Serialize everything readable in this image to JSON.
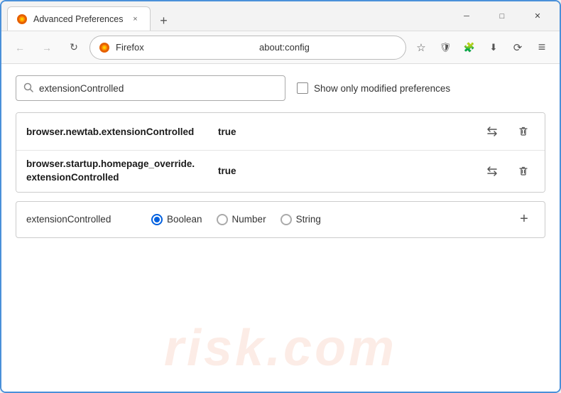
{
  "window": {
    "title": "Advanced Preferences",
    "tab_close_label": "×",
    "new_tab_label": "+",
    "minimize_label": "─",
    "maximize_label": "□",
    "close_label": "✕"
  },
  "nav": {
    "back_label": "←",
    "forward_label": "→",
    "refresh_label": "↻",
    "browser_name": "Firefox",
    "address": "about:config",
    "bookmark_icon": "☆",
    "shield_icon": "🛡",
    "extension_icon": "🧩",
    "download_icon": "⬇",
    "history_icon": "⟳",
    "menu_icon": "≡"
  },
  "search": {
    "placeholder": "extensionControlled",
    "value": "extensionControlled",
    "show_modified_label": "Show only modified preferences"
  },
  "results": [
    {
      "name": "browser.newtab.extensionControlled",
      "value": "true"
    },
    {
      "name_line1": "browser.startup.homepage_override.",
      "name_line2": "extensionControlled",
      "value": "true"
    }
  ],
  "add_pref": {
    "name": "extensionControlled",
    "type_options": [
      "Boolean",
      "Number",
      "String"
    ],
    "selected_type": "Boolean"
  },
  "watermark": "risk.com"
}
